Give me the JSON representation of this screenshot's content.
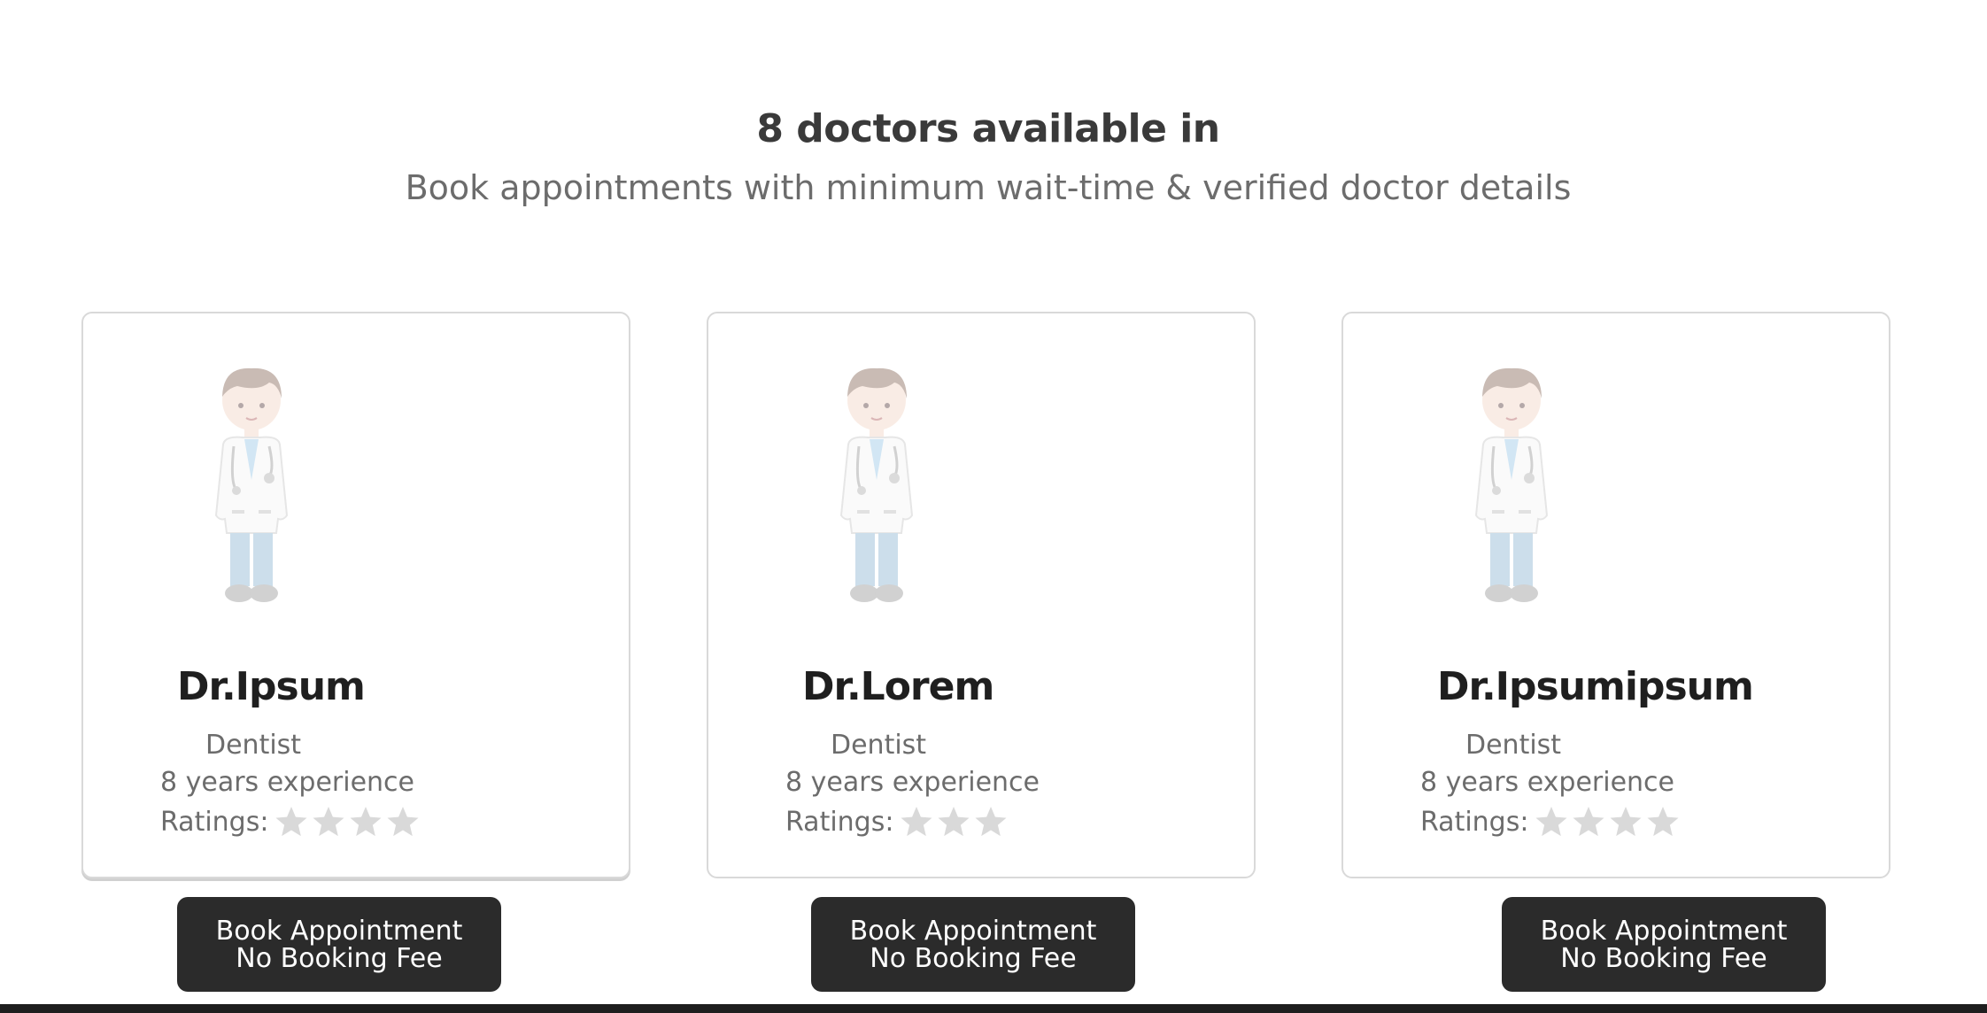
{
  "header": {
    "title": "8 doctors available in",
    "subtitle": "Book appointments with minimum wait-time & verified doctor details"
  },
  "doctors": [
    {
      "name": "Dr.Ipsum",
      "specialty": "Dentist",
      "experience": "8 years experience",
      "ratings_label": "Ratings:",
      "stars": 4,
      "button_line1": "Book Appointment",
      "button_line2": "No Booking Fee"
    },
    {
      "name": "Dr.Lorem",
      "specialty": "Dentist",
      "experience": "8 years experience",
      "ratings_label": "Ratings:",
      "stars": 3,
      "button_line1": "Book Appointment",
      "button_line2": "No Booking Fee"
    },
    {
      "name": "Dr.Ipsumipsum",
      "specialty": "Dentist",
      "experience": "8 years experience",
      "ratings_label": "Ratings:",
      "stars": 4,
      "button_line1": "Book Appointment",
      "button_line2": "No Booking Fee"
    }
  ],
  "icons": {
    "doctor_avatar": "doctor-illustration-icon",
    "rating": "star-icon"
  },
  "colors": {
    "button_bg": "#2b2b2b",
    "star": "#d9d9d9",
    "heading": "#3a3a3a"
  }
}
